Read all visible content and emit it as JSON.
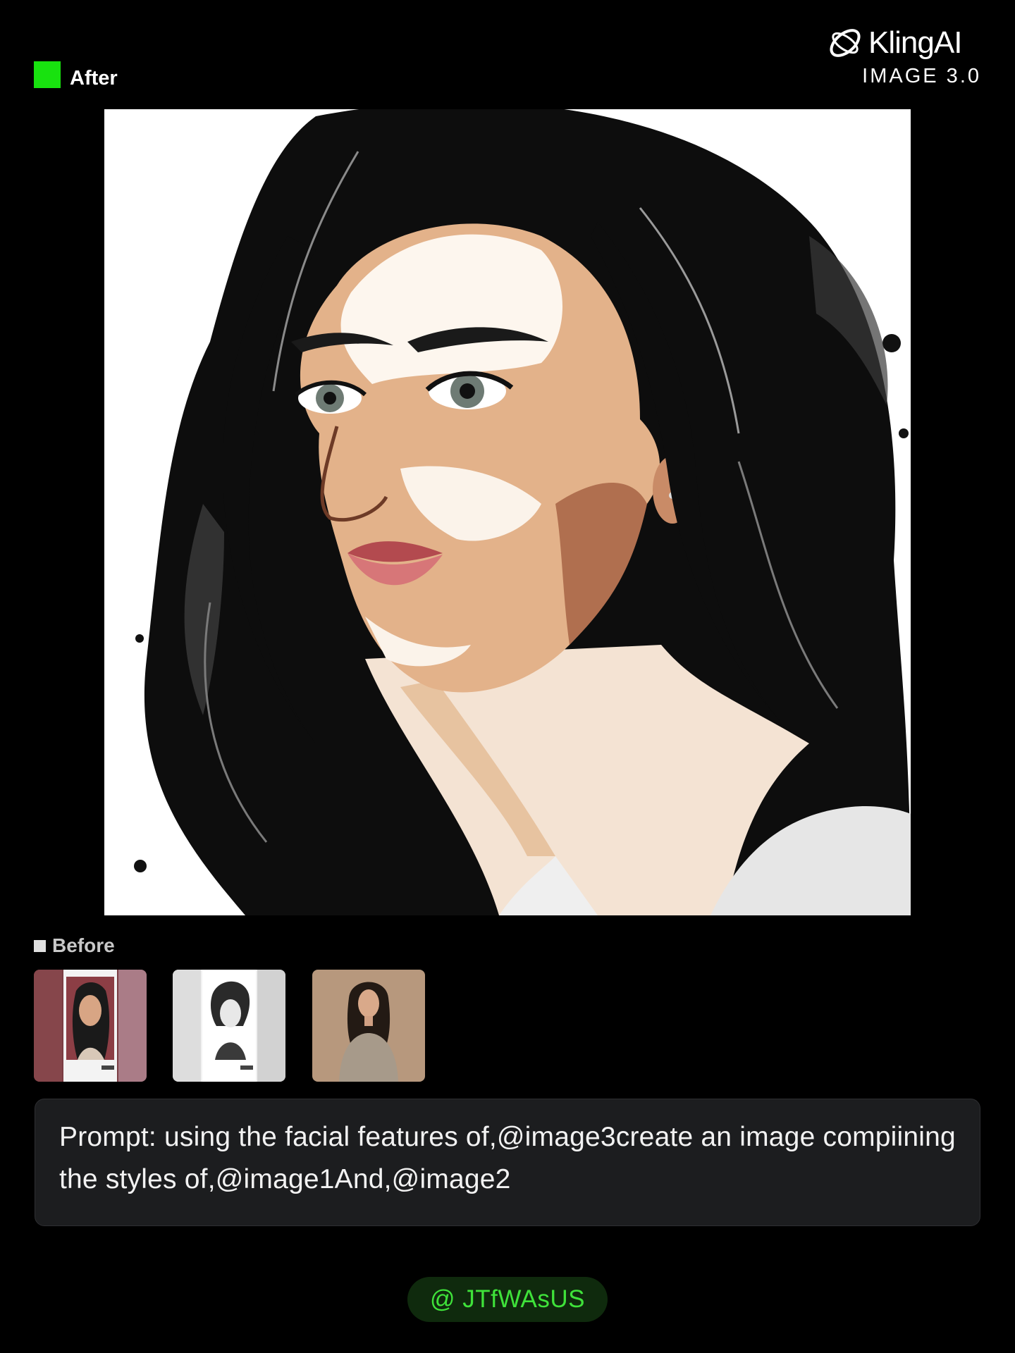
{
  "brand": {
    "name": "KlingAI",
    "product": "IMAGE 3.0",
    "icon": "kling-logo-icon"
  },
  "after": {
    "label": "After",
    "marker_color": "#18e20f",
    "image_icon": "generated-portrait-image"
  },
  "before": {
    "label": "Before",
    "thumbnails": [
      {
        "name": "image1",
        "icon": "reference-image-1"
      },
      {
        "name": "image2",
        "icon": "reference-image-2"
      },
      {
        "name": "image3",
        "icon": "reference-image-3"
      }
    ]
  },
  "prompt": {
    "text": "Prompt: using the facial features of,@image3create an image compiining the styles of,@image1And,@image2"
  },
  "author": {
    "handle": "@ JTfWAsUS",
    "color": "#3fe23a"
  }
}
